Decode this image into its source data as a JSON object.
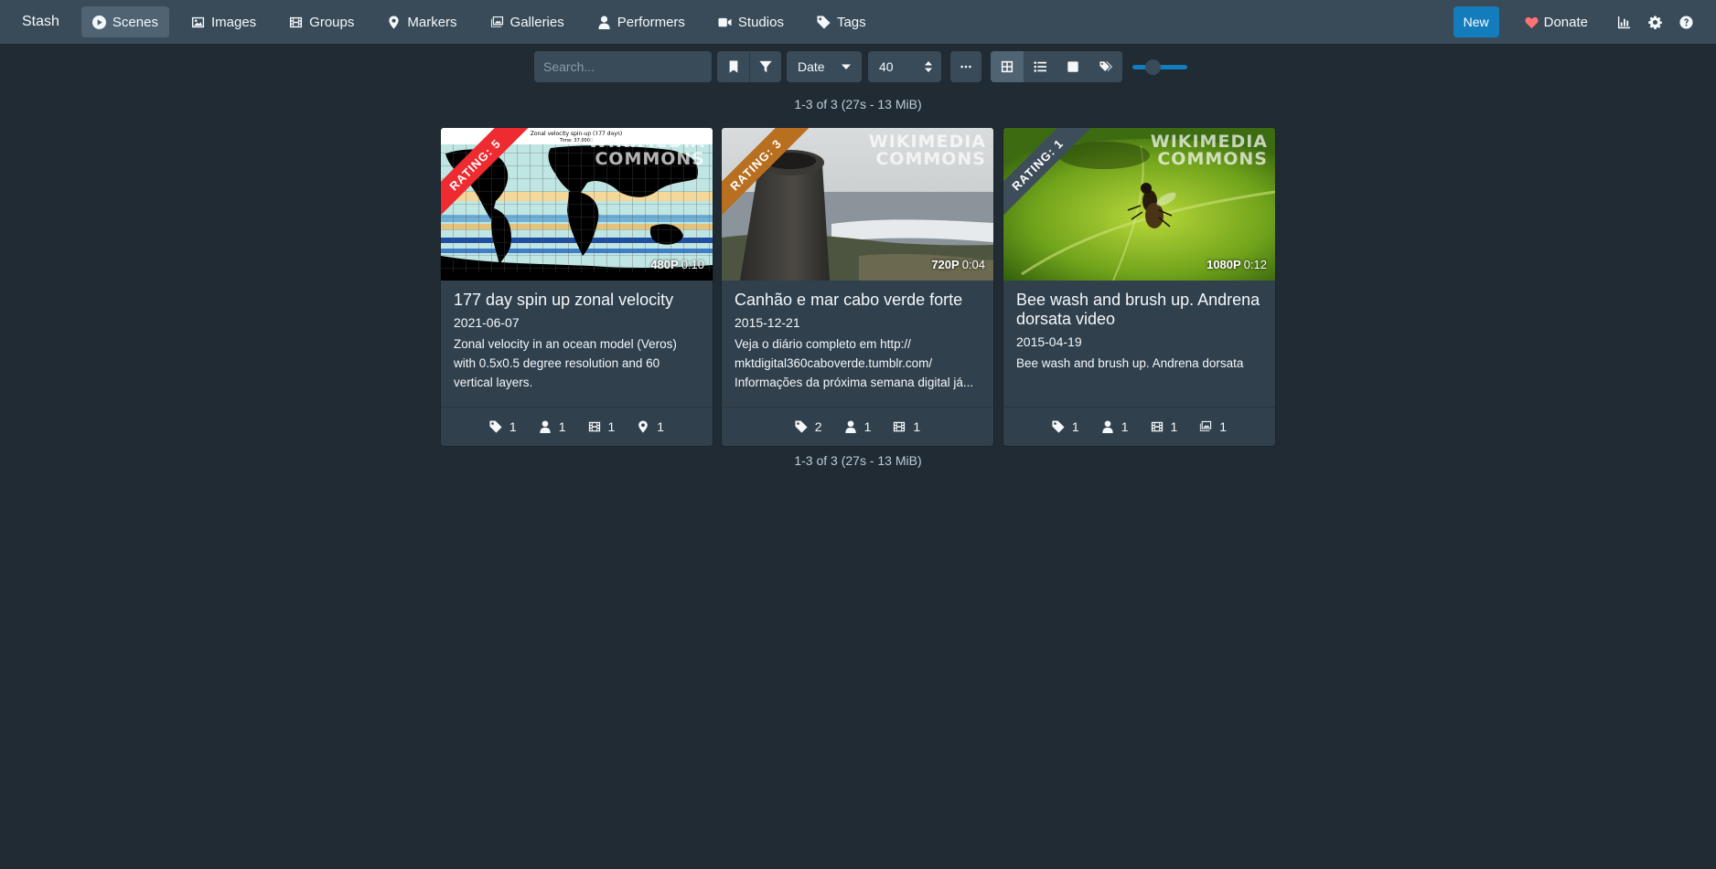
{
  "nav": {
    "brand": "Stash",
    "items": [
      {
        "label": "Scenes",
        "icon": "play-circle-icon",
        "active": true
      },
      {
        "label": "Images",
        "icon": "image-icon"
      },
      {
        "label": "Groups",
        "icon": "film-icon"
      },
      {
        "label": "Markers",
        "icon": "map-marker-icon"
      },
      {
        "label": "Galleries",
        "icon": "images-icon"
      },
      {
        "label": "Performers",
        "icon": "user-icon"
      },
      {
        "label": "Studios",
        "icon": "video-icon"
      },
      {
        "label": "Tags",
        "icon": "tag-icon"
      }
    ],
    "new_label": "New",
    "donate_label": "Donate"
  },
  "toolbar": {
    "search_placeholder": "Search...",
    "sort_value": "Date",
    "per_page_value": "40"
  },
  "result_count": "1-3 of 3 (27s - 13 MiB)",
  "colors": {
    "accent": "#137cbd",
    "rating5": "#ed2b30",
    "rating3": "#b86f1f",
    "rating1": "#3d4d5a"
  },
  "scenes": [
    {
      "title": "177 day spin up zonal velocity",
      "date": "2021-06-07",
      "description_lines": [
        "Zonal velocity in an ocean model (Veros)",
        "with 0.5x0.5 degree resolution and 60",
        "vertical layers."
      ],
      "rating_label": "RATING: 5",
      "resolution": "480P",
      "duration": "0:10",
      "thumb_caption": "Zonal velocity spin-up (177 days)",
      "thumb_time": "Time: 37.0000",
      "counts": {
        "tags": "1",
        "performers": "1",
        "groups": "1",
        "markers": "1"
      }
    },
    {
      "title": "Canhão e mar cabo verde forte",
      "date": "2015-12-21",
      "description_lines": [
        "Veja o diário completo em http://",
        "mktdigital360caboverde.tumblr.com/",
        "Informações da próxima semana digital já..."
      ],
      "rating_label": "RATING: 3",
      "resolution": "720P",
      "duration": "0:04",
      "counts": {
        "tags": "2",
        "performers": "1",
        "groups": "1"
      }
    },
    {
      "title_lines": [
        "Bee wash and brush up. Andrena",
        "dorsata video"
      ],
      "date": "2015-04-19",
      "description_lines": [
        "Bee wash and brush up. Andrena dorsata"
      ],
      "rating_label": "RATING: 1",
      "resolution": "1080P",
      "duration": "0:12",
      "counts": {
        "tags": "1",
        "performers": "1",
        "groups": "1",
        "galleries": "1"
      }
    }
  ],
  "watermark": {
    "line1": "WIKIMEDIA",
    "line2": "COMMONS"
  }
}
